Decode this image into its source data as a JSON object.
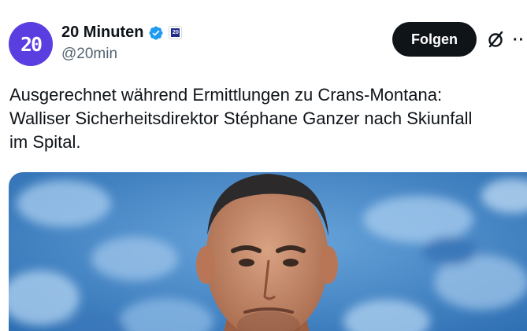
{
  "author": {
    "display_name": "20 Minuten",
    "handle": "@20min",
    "avatar_text": "20",
    "avatar_color": "#5a3ee0",
    "verified": true,
    "affiliate_badge": "20"
  },
  "actions": {
    "follow_label": "Folgen",
    "grok_icon": "grok-icon",
    "more_icon": "more-icon",
    "more_glyph": "··"
  },
  "tweet": {
    "lines": [
      "Ausgerechnet während Ermittlungen zu Crans-Montana:",
      "Walliser Sicherheitsdirektor Stéphane Ganzer nach Skiunfall",
      "im Spital."
    ]
  },
  "media": {
    "type": "photo",
    "subject": "portrait-photo",
    "background_color": "#3f86c8"
  },
  "colors": {
    "text": "#0f1419",
    "secondary": "#536471",
    "verified_blue": "#1d9bf0",
    "follow_bg": "#0f1419"
  }
}
